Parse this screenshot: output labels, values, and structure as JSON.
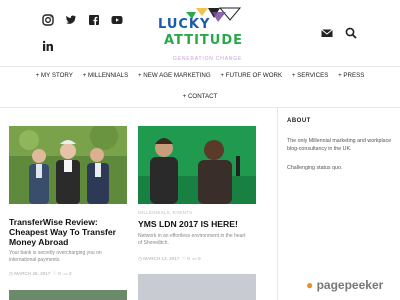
{
  "social": {
    "icons": [
      "instagram-icon",
      "twitter-icon",
      "facebook-icon",
      "youtube-icon",
      "linkedin-icon"
    ]
  },
  "header": {
    "logo_line1": "LUCKY",
    "logo_line2": "ATTITUDE",
    "tagline": "GENERATION CHANGE",
    "mail_icon": "mail-icon",
    "search_icon": "search-icon"
  },
  "nav": {
    "items": [
      "+ MY STORY",
      "+ MILLENNIALS",
      "+ NEW AGE MARKETING",
      "+ FUTURE OF WORK",
      "+ SERVICES",
      "+ PRESS"
    ],
    "contact": "+ CONTACT"
  },
  "posts": [
    {
      "title": "TransferWise Review: Cheapest Way To Transfer Money Abroad",
      "excerpt": "Your bank is secretly overcharging you on international payments.",
      "date": "MARCH 26, 2017",
      "likes": "0",
      "comments": "2"
    },
    {
      "category": "MILLENNIALS, EVENTS",
      "title": "YMS LDN 2017 IS HERE!",
      "excerpt": "Network in an effortless environment in the heart of Shoreditch.",
      "date": "MARCH 13, 2017",
      "likes": "0",
      "comments": "0"
    }
  ],
  "sidebar": {
    "heading": "ABOUT",
    "body": "The only Millennial marketing and workplace blog-consultancy in the UK.",
    "sub": "Challenging status quo."
  },
  "watermark": {
    "brand": "pagepeeker"
  },
  "colors": {
    "accent": "#6cc04a",
    "logo_green": "#2aa84a",
    "logo_purple": "#7a4ba0",
    "logo_blue": "#1d5aa8"
  }
}
